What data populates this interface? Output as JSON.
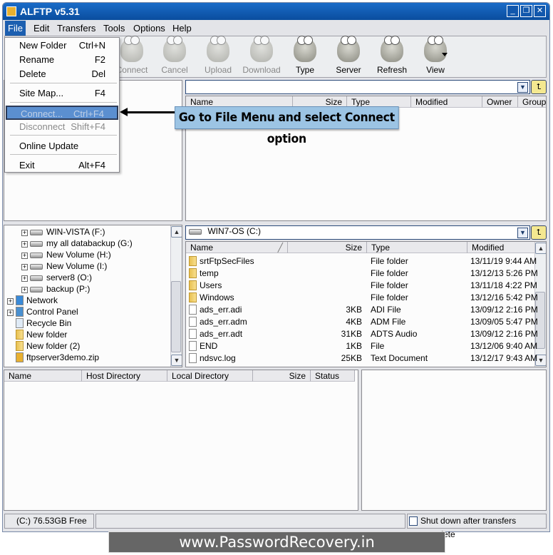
{
  "window": {
    "title": "ALFTP v5.31",
    "minimize": "_",
    "restore": "❐",
    "close": "✕"
  },
  "menubar": [
    "File",
    "Edit",
    "Transfers",
    "Tools",
    "Options",
    "Help"
  ],
  "toolbar": [
    {
      "label": "Connect",
      "enabled": false
    },
    {
      "label": "Cancel",
      "enabled": false
    },
    {
      "label": "Upload",
      "enabled": false
    },
    {
      "label": "Download",
      "enabled": false
    },
    {
      "label": "Type",
      "enabled": true
    },
    {
      "label": "Server",
      "enabled": true
    },
    {
      "label": "Refresh",
      "enabled": true
    },
    {
      "label": "View",
      "enabled": true
    }
  ],
  "file_menu": [
    {
      "label": "New Folder",
      "shortcut": "Ctrl+N"
    },
    {
      "label": "Rename",
      "shortcut": "F2"
    },
    {
      "label": "Delete",
      "shortcut": "Del"
    },
    {
      "label": "Site Map...",
      "shortcut": "F4"
    },
    {
      "label": "Connect...",
      "shortcut": "Ctrl+F4",
      "highlighted": true,
      "disabled": true
    },
    {
      "label": "Disconnect",
      "shortcut": "Shift+F4",
      "disabled": true
    },
    {
      "label": "Online Update",
      "shortcut": ""
    },
    {
      "label": "Exit",
      "shortcut": "Alt+F4"
    }
  ],
  "callout": "Go to File Menu and select Connect option",
  "remote": {
    "path": "",
    "columns": [
      "Name",
      "Size",
      "Type",
      "Modified",
      "Owner",
      "Group"
    ]
  },
  "tree": [
    {
      "label": "WIN-VISTA (F:)",
      "icon": "drive",
      "level": 1,
      "expandable": true
    },
    {
      "label": "my all databackup (G:)",
      "icon": "drive",
      "level": 1,
      "expandable": true
    },
    {
      "label": "New Volume (H:)",
      "icon": "drive",
      "level": 1,
      "expandable": true
    },
    {
      "label": "New Volume (I:)",
      "icon": "drive",
      "level": 1,
      "expandable": true
    },
    {
      "label": "server8 (O:)",
      "icon": "drive",
      "level": 1,
      "expandable": true
    },
    {
      "label": "backup (P:)",
      "icon": "drive",
      "level": 1,
      "expandable": true
    },
    {
      "label": "Network",
      "icon": "network",
      "level": 0,
      "expandable": true
    },
    {
      "label": "Control Panel",
      "icon": "control-panel",
      "level": 0,
      "expandable": true
    },
    {
      "label": "Recycle Bin",
      "icon": "recycle-bin",
      "level": 0,
      "expandable": false
    },
    {
      "label": "New folder",
      "icon": "folder",
      "level": 0,
      "expandable": false
    },
    {
      "label": "New folder (2)",
      "icon": "folder",
      "level": 0,
      "expandable": false
    },
    {
      "label": "ftpserver3demo.zip",
      "icon": "zip",
      "level": 0,
      "expandable": false
    }
  ],
  "local": {
    "path": "WIN7-OS (C:)",
    "columns": [
      "Name",
      "Size",
      "Type",
      "Modified"
    ],
    "files": [
      {
        "name": "srtFtpSecFiles",
        "size": "",
        "type": "File folder",
        "modified": "13/11/19 9:44 AM",
        "icon": "folder"
      },
      {
        "name": "temp",
        "size": "",
        "type": "File folder",
        "modified": "13/12/13 5:26 PM",
        "icon": "folder"
      },
      {
        "name": "Users",
        "size": "",
        "type": "File folder",
        "modified": "13/11/18 4:22 PM",
        "icon": "folder"
      },
      {
        "name": "Windows",
        "size": "",
        "type": "File folder",
        "modified": "13/12/16 5:42 PM",
        "icon": "folder"
      },
      {
        "name": "ads_err.adi",
        "size": "3KB",
        "type": "ADI File",
        "modified": "13/09/12 2:16 PM",
        "icon": "file"
      },
      {
        "name": "ads_err.adm",
        "size": "4KB",
        "type": "ADM File",
        "modified": "13/09/05 5:47 PM",
        "icon": "file"
      },
      {
        "name": "ads_err.adt",
        "size": "31KB",
        "type": "ADTS Audio",
        "modified": "13/09/12 2:16 PM",
        "icon": "audio"
      },
      {
        "name": "END",
        "size": "1KB",
        "type": "File",
        "modified": "13/12/06 9:40 AM",
        "icon": "file"
      },
      {
        "name": "ndsvc.log",
        "size": "25KB",
        "type": "Text Document",
        "modified": "13/12/17 9:43 AM",
        "icon": "text"
      }
    ]
  },
  "queue": {
    "columns": [
      "Name",
      "Host Directory",
      "Local Directory",
      "Size",
      "Status"
    ]
  },
  "status": {
    "free": "(C:)  76.53GB Free",
    "shutdown_label": "Shut down after transfers complete",
    "shutdown_checked": false
  },
  "watermark": "www.PasswordRecovery.in"
}
